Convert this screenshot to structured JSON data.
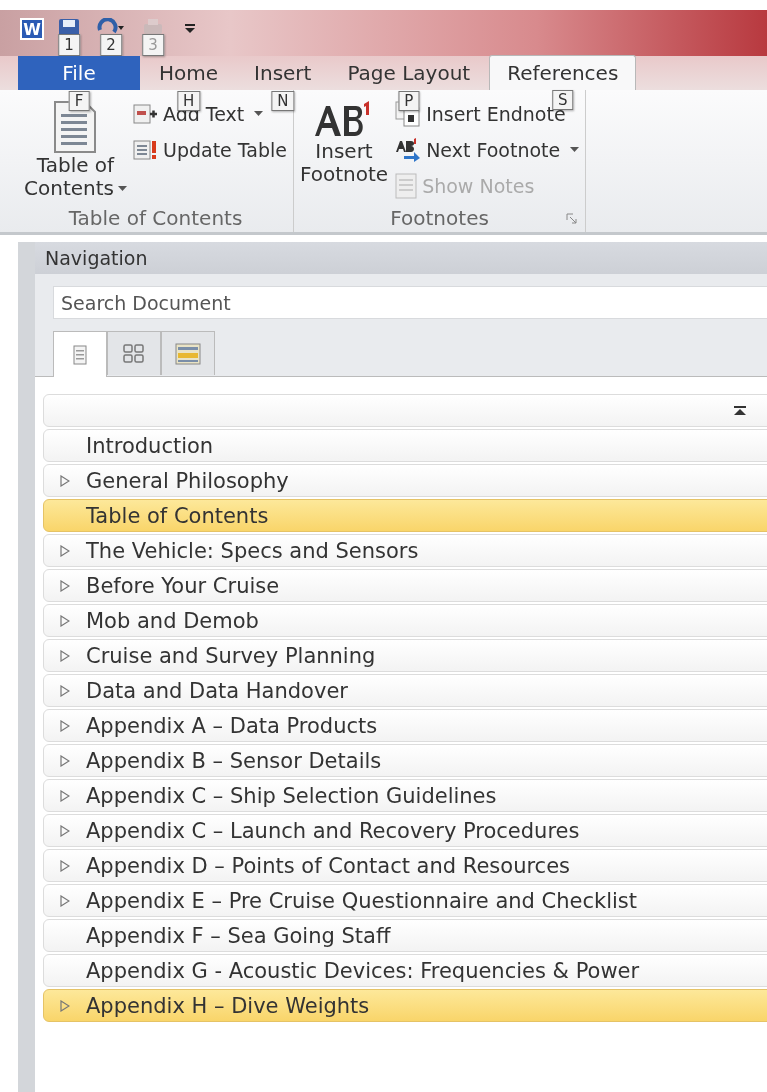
{
  "app_logo": "W",
  "quick_access": [
    {
      "kind": "save",
      "keytip": "1",
      "disabled": false
    },
    {
      "kind": "undo",
      "keytip": "2",
      "disabled": false
    },
    {
      "kind": "redo",
      "keytip": "3",
      "disabled": true
    }
  ],
  "tabs": [
    {
      "label": "File",
      "keytip": "F",
      "kind": "file",
      "selected": false
    },
    {
      "label": "Home",
      "keytip": "H",
      "kind": "tab",
      "selected": false
    },
    {
      "label": "Insert",
      "keytip": "N",
      "kind": "tab",
      "selected": false
    },
    {
      "label": "Page Layout",
      "keytip": "P",
      "kind": "tab",
      "selected": false
    },
    {
      "label": "References",
      "keytip": "S",
      "kind": "tab",
      "selected": true
    }
  ],
  "groups": [
    {
      "label": "Table of Contents",
      "launcher": false,
      "big": {
        "kind": "toc",
        "lines": [
          "Table of",
          "Contents"
        ],
        "dropdown": true
      },
      "small": [
        {
          "kind": "addtext",
          "label": "Add Text",
          "dropdown": true,
          "disabled": false
        },
        {
          "kind": "update",
          "label": "Update Table",
          "dropdown": false,
          "disabled": false
        }
      ]
    },
    {
      "label": "Footnotes",
      "launcher": true,
      "big": {
        "kind": "footnote",
        "lines": [
          "Insert",
          "Footnote"
        ],
        "dropdown": false
      },
      "small": [
        {
          "kind": "endnote",
          "label": "Insert Endnote",
          "dropdown": false,
          "disabled": false
        },
        {
          "kind": "next",
          "label": "Next Footnote",
          "dropdown": true,
          "disabled": false
        },
        {
          "kind": "notes",
          "label": "Show Notes",
          "dropdown": false,
          "disabled": true
        }
      ]
    }
  ],
  "navigation": {
    "title": "Navigation",
    "search": {
      "placeholder": "Search Document"
    },
    "view_tabs": [
      {
        "kind": "headings",
        "selected": true
      },
      {
        "kind": "pages",
        "selected": false
      },
      {
        "kind": "results",
        "selected": false
      }
    ],
    "headings": [
      {
        "label": "Introduction",
        "expandable": false,
        "selected": false
      },
      {
        "label": "General Philosophy",
        "expandable": true,
        "selected": false
      },
      {
        "label": "Table of Contents",
        "expandable": false,
        "selected": true
      },
      {
        "label": "The Vehicle: Specs and Sensors",
        "expandable": true,
        "selected": false
      },
      {
        "label": "Before Your Cruise",
        "expandable": true,
        "selected": false
      },
      {
        "label": "Mob and Demob",
        "expandable": true,
        "selected": false
      },
      {
        "label": "Cruise and Survey Planning",
        "expandable": true,
        "selected": false
      },
      {
        "label": "Data and Data Handover",
        "expandable": true,
        "selected": false
      },
      {
        "label": "Appendix A – Data Products",
        "expandable": true,
        "selected": false
      },
      {
        "label": "Appendix B – Sensor Details",
        "expandable": true,
        "selected": false
      },
      {
        "label": "Appendix C – Ship Selection Guidelines",
        "expandable": true,
        "selected": false
      },
      {
        "label": "Appendix C – Launch and Recovery Procedures",
        "expandable": true,
        "selected": false
      },
      {
        "label": "Appendix D – Points of Contact and Resources",
        "expandable": true,
        "selected": false
      },
      {
        "label": "Appendix E – Pre Cruise Questionnaire and Checklist",
        "expandable": true,
        "selected": false
      },
      {
        "label": "Appendix F – Sea Going Staff",
        "expandable": false,
        "selected": false
      },
      {
        "label": "Appendix G - Acoustic Devices: Frequencies & Power",
        "expandable": false,
        "selected": false
      },
      {
        "label": "Appendix H – Dive Weights",
        "expandable": true,
        "selected": true
      }
    ]
  }
}
